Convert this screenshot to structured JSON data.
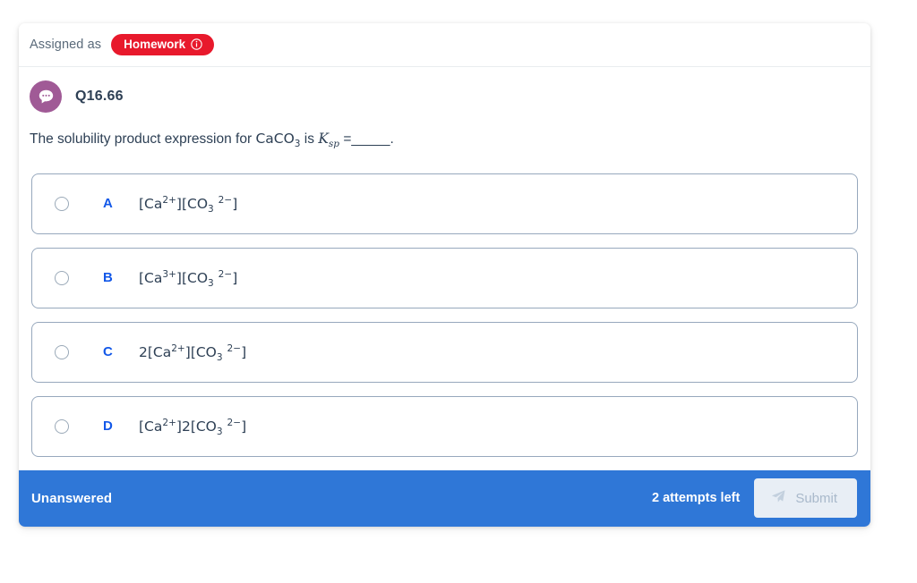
{
  "header": {
    "assigned_label": "Assigned as",
    "badge_label": "Homework",
    "badge_info_icon": "info-circle-icon",
    "badge_color": "#e8192c"
  },
  "question": {
    "avatar_icon": "speech-bubble-icon",
    "avatar_color": "#a05a96",
    "id": "Q16.66",
    "stem": {
      "text_before": "The solubility product expression for ",
      "formula_compound": "CaCO3",
      "text_middle": " is ",
      "symbol": "Ksp",
      "text_after": " =_____."
    }
  },
  "options": [
    {
      "letter": "A",
      "expression": "[Ca2+][CO3 2-]",
      "selected": false
    },
    {
      "letter": "B",
      "expression": "[Ca3+][CO3 2-]",
      "selected": false
    },
    {
      "letter": "C",
      "expression": "2[Ca2+][CO3 2-]",
      "selected": false
    },
    {
      "letter": "D",
      "expression": "[Ca2+]2[CO3 2-]",
      "selected": false
    }
  ],
  "footer": {
    "status": "Unanswered",
    "attempts": "2 attempts left",
    "submit_label": "Submit",
    "submit_icon": "send-paper-plane-icon",
    "submit_disabled": true,
    "bar_color": "#2f77d7"
  }
}
